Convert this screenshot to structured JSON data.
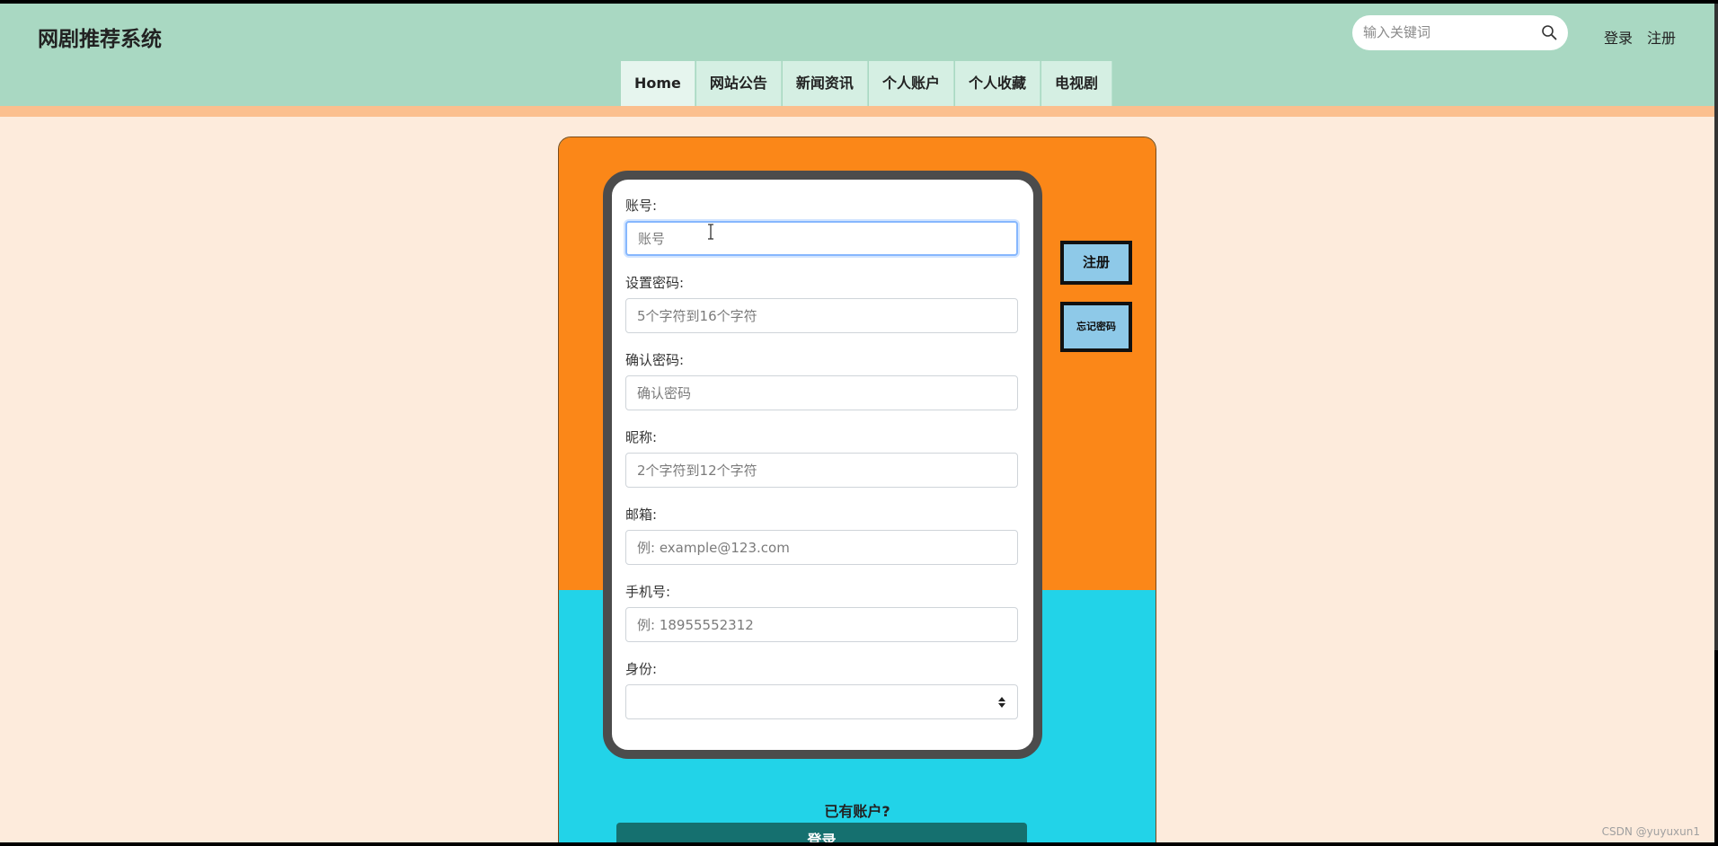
{
  "header": {
    "brand": "网剧推荐系统",
    "search_placeholder": "输入关键词",
    "login_link": "登录",
    "register_link": "注册",
    "nav": [
      {
        "label": "Home",
        "active": true
      },
      {
        "label": "网站公告"
      },
      {
        "label": "新闻资讯"
      },
      {
        "label": "个人账户"
      },
      {
        "label": "个人收藏"
      },
      {
        "label": "电视剧"
      }
    ]
  },
  "form": {
    "account_label": "账号:",
    "account_placeholder": "账号",
    "password_label": "设置密码:",
    "password_placeholder": "5个字符到16个字符",
    "confirm_label": "确认密码:",
    "confirm_placeholder": "确认密码",
    "nickname_label": "昵称:",
    "nickname_placeholder": "2个字符到12个字符",
    "email_label": "邮箱:",
    "email_placeholder": "例: example@123.com",
    "phone_label": "手机号:",
    "phone_placeholder": "例: 18955552312",
    "role_label": "身份:",
    "role_value": ""
  },
  "side_buttons": {
    "register": "注册",
    "forgot": "忘记密码"
  },
  "footer": {
    "has_account": "已有账户?",
    "login_button": "登录",
    "watermark": "CSDN @yuyuxun1"
  },
  "colors": {
    "header_bg": "#a9d8c2",
    "page_bg": "#fdebdc",
    "panel_orange": "#fb8718",
    "panel_cyan": "#22d3e8",
    "side_button_bg": "#8ec9e8",
    "login_button_bg": "#15706f"
  }
}
